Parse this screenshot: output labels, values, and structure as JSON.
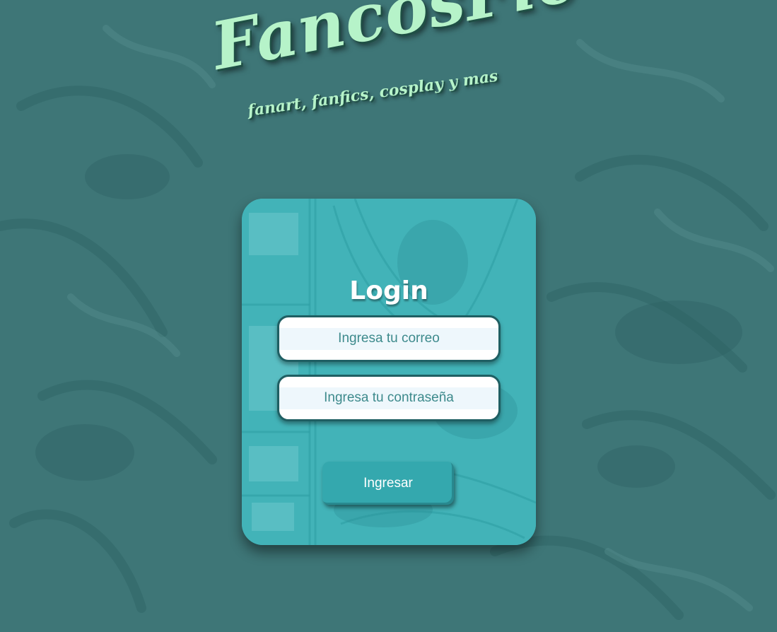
{
  "logo": {
    "title": "FancosFic",
    "tagline": "fanart, fanfics, cosplay y mas"
  },
  "login": {
    "title": "Login",
    "email_placeholder": "Ingresa tu correo",
    "password_placeholder": "Ingresa tu contraseña",
    "submit_label": "Ingresar"
  },
  "colors": {
    "background": "#3e7677",
    "card": "#42b3b8",
    "logo_text": "#b6f3c9",
    "button": "#34a8ae",
    "input_text": "#3d8a8c"
  }
}
